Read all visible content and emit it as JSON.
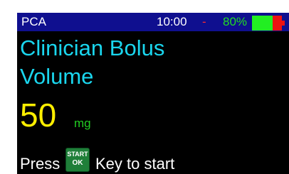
{
  "status_bar": {
    "mode": "PCA",
    "time": "10:00",
    "separator": "-",
    "battery_percent_text": "80%",
    "battery_level": 0.7,
    "colors": {
      "background": "#0f0f8f",
      "battery_ok": "#22ee22",
      "battery_low": "#ee1111"
    }
  },
  "main": {
    "title_line1": "Clinician Bolus",
    "title_line2": "Volume",
    "value": "50",
    "unit": "mg"
  },
  "prompt": {
    "before": "Press",
    "key_top": "START",
    "key_bottom": "OK",
    "after": "Key to start"
  },
  "colors": {
    "screen_background": "#000000",
    "title": "#1ad6ee",
    "value": "#ffee00",
    "unit": "#22cc22",
    "prompt": "#ffffff",
    "key_green": "#1f7f39"
  },
  "icons": {
    "battery": "battery-icon",
    "start_ok_key": "start-ok-key-icon"
  }
}
